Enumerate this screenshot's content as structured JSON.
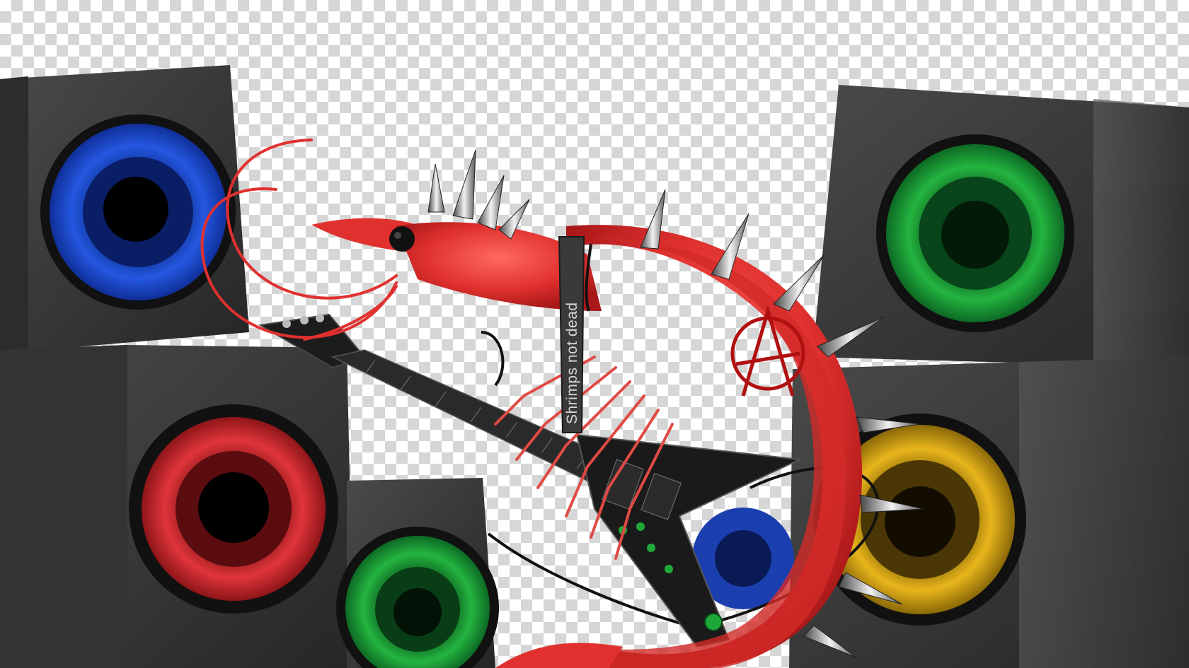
{
  "scene": {
    "subject": "",
    "strap_text": "Shrimps not dead",
    "colors": {
      "shrimp": "#e0312f",
      "speaker_blue": "#1f4fd6",
      "speaker_green": "#1ea83a",
      "speaker_red": "#d7262b",
      "speaker_yellow": "#d9a814",
      "cabinet": "#3a3a3a",
      "guitar": "#1c1c1c",
      "checker_light": "#ffffff",
      "checker_dark": "#d6d6d6"
    }
  }
}
